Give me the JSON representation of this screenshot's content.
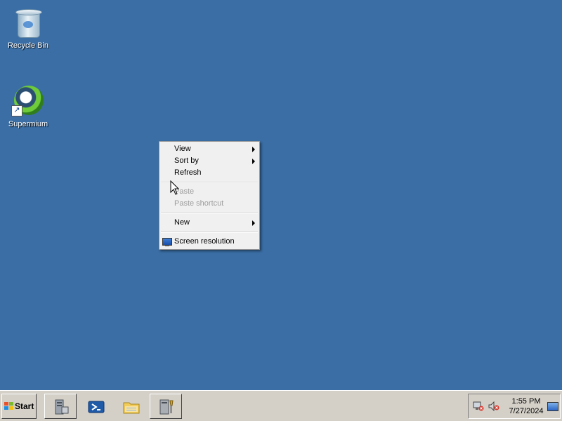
{
  "desktop": {
    "icons": [
      {
        "label": "Recycle Bin",
        "icon": "recycle-bin-icon"
      },
      {
        "label": "Supermium",
        "icon": "supermium-browser-icon"
      }
    ]
  },
  "context_menu": {
    "items": [
      {
        "label": "View",
        "has_submenu": true,
        "enabled": true
      },
      {
        "label": "Sort by",
        "has_submenu": true,
        "enabled": true
      },
      {
        "label": "Refresh",
        "has_submenu": false,
        "enabled": true
      },
      {
        "label": "Paste",
        "has_submenu": false,
        "enabled": false
      },
      {
        "label": "Paste shortcut",
        "has_submenu": false,
        "enabled": false
      },
      {
        "label": "New",
        "has_submenu": true,
        "enabled": true
      },
      {
        "label": "Screen resolution",
        "has_submenu": false,
        "enabled": true,
        "icon": "monitor-icon"
      }
    ]
  },
  "taskbar": {
    "start_label": "Start",
    "pinned": [
      {
        "icon": "server-manager-icon"
      },
      {
        "icon": "powershell-icon"
      },
      {
        "icon": "explorer-folder-icon"
      },
      {
        "icon": "admin-tools-icon"
      }
    ],
    "tray": {
      "icons": [
        "network-error-icon",
        "volume-muted-icon"
      ],
      "time": "1:55 PM",
      "date": "7/27/2024"
    }
  },
  "colors": {
    "desktop_background": "#3a6ea5",
    "menu_background": "#f0f0f0",
    "taskbar_background": "#d4d0c8"
  }
}
